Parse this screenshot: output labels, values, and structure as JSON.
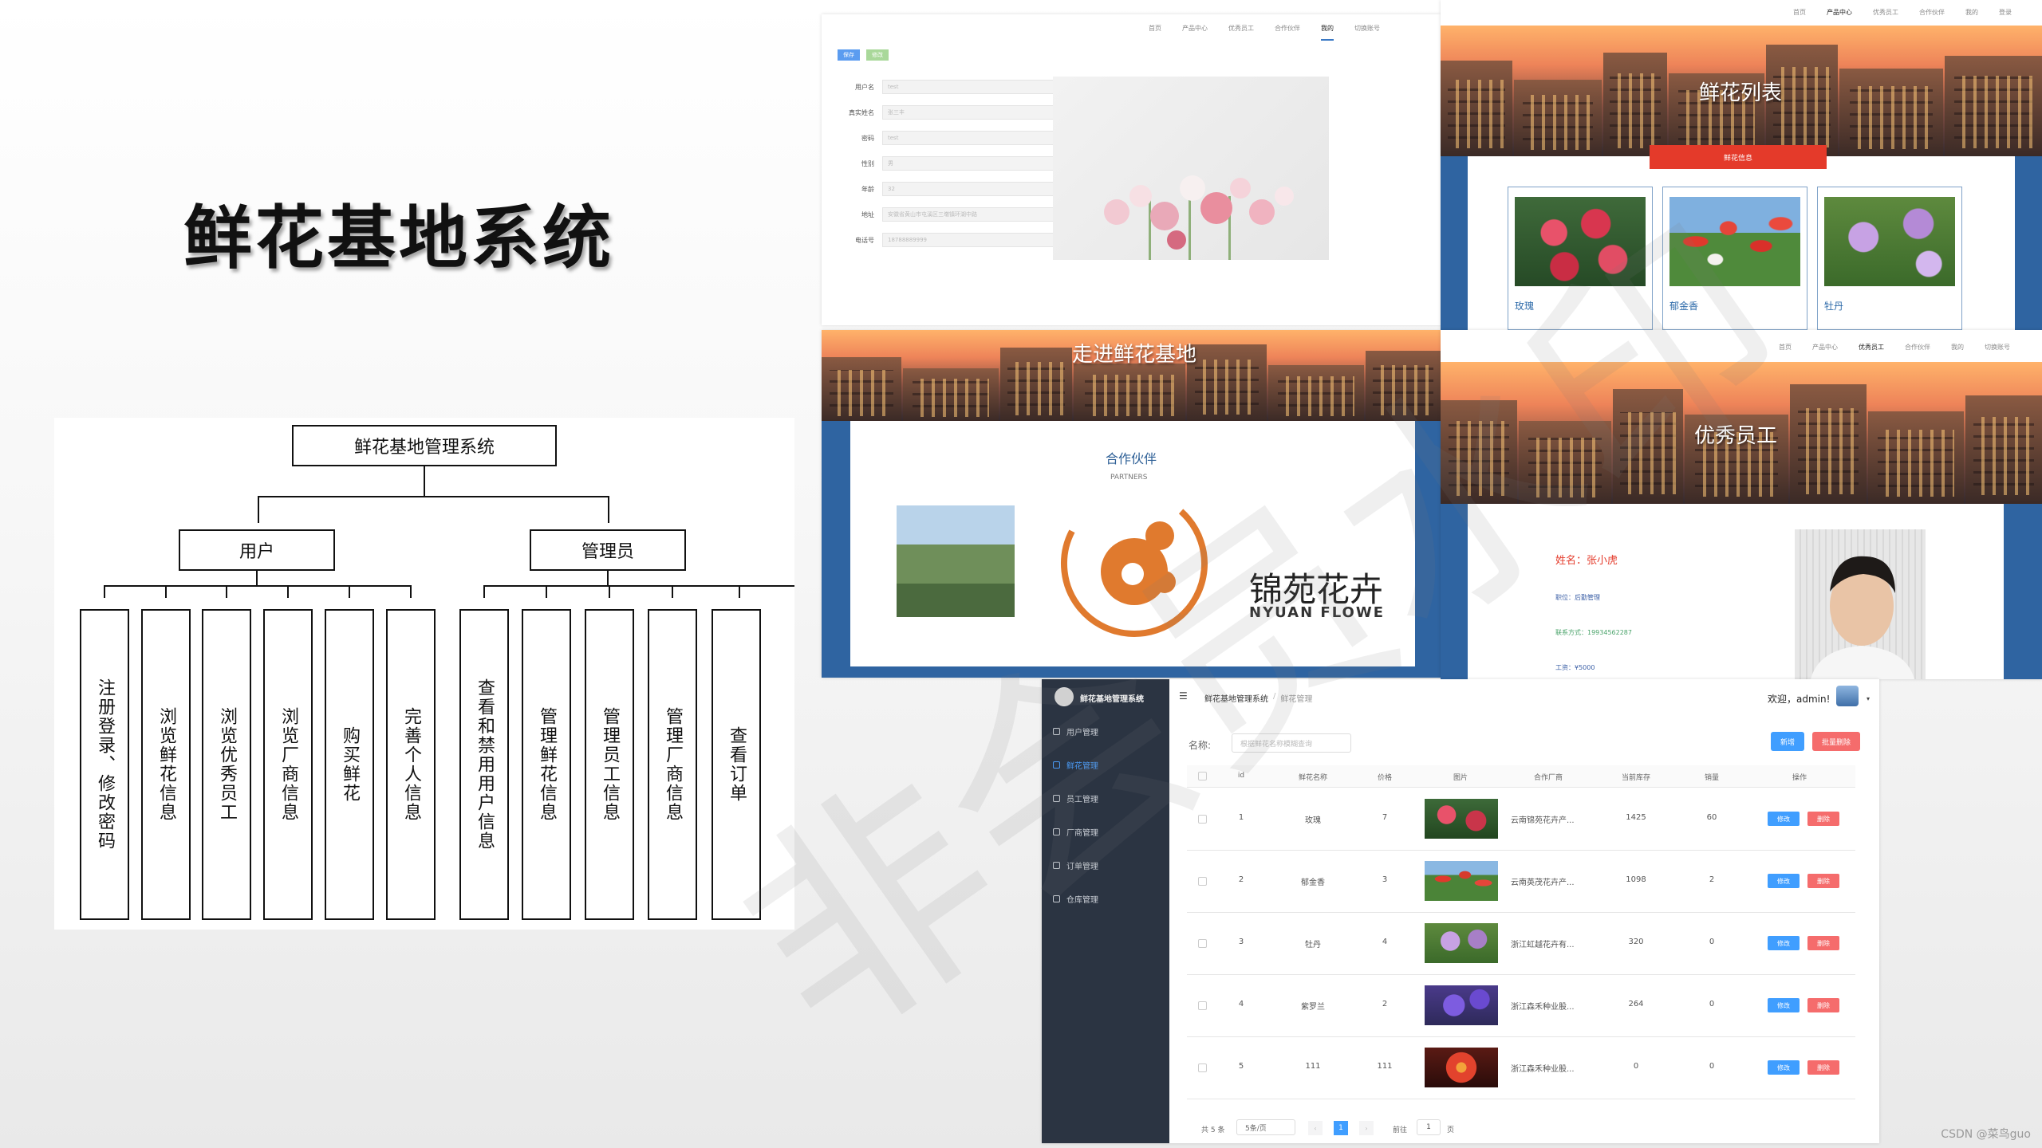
{
  "slide_title": "鲜花基地系统",
  "org_chart": {
    "root": "鲜花基地管理系统",
    "branches": [
      {
        "label": "用户",
        "children": [
          "注册登录、修改密码",
          "浏览鲜花信息",
          "浏览优秀员工",
          "浏览厂商信息",
          "购买鲜花",
          "完善个人信息"
        ]
      },
      {
        "label": "管理员",
        "children": [
          "查看和禁用用户信息",
          "管理鲜花信息",
          "管理员工信息",
          "管理厂商信息",
          "查看订单"
        ]
      }
    ]
  },
  "profile_panel": {
    "nav": [
      "首页",
      "产品中心",
      "优秀员工",
      "合作伙伴",
      "我的",
      "切换账号"
    ],
    "nav_active": "我的",
    "buttons": [
      "保存",
      "修改"
    ],
    "fields": [
      {
        "label": "用户名",
        "value": "test"
      },
      {
        "label": "真实姓名",
        "value": "张三丰"
      },
      {
        "label": "密码",
        "value": "test"
      },
      {
        "label": "性别",
        "value": "男"
      },
      {
        "label": "年龄",
        "value": "32"
      },
      {
        "label": "地址",
        "value": "安徽省黄山市屯溪区三墩镇环湖中路"
      },
      {
        "label": "电话号",
        "value": "18788889999"
      }
    ]
  },
  "flower_list_panel": {
    "nav": [
      "首页",
      "产品中心",
      "优秀员工",
      "合作伙伴",
      "我的",
      "登录"
    ],
    "nav_active": "产品中心",
    "banner_title": "鲜花列表",
    "tab_label": "鲜花信息",
    "cards": [
      {
        "name": "玫瑰",
        "color": "#d8364f"
      },
      {
        "name": "郁金香",
        "color": "#e0392c"
      },
      {
        "name": "牡丹",
        "color": "#b48ad6"
      }
    ]
  },
  "partners_panel": {
    "banner_title": "走进鲜花基地",
    "section_title": "合作伙伴",
    "section_sub": "PARTNERS",
    "partner_text_cn": "锦苑花卉",
    "partner_text_en": "NYUAN FLOWE"
  },
  "staff_panel": {
    "nav": [
      "首页",
      "产品中心",
      "优秀员工",
      "合作伙伴",
      "我的",
      "切换账号"
    ],
    "nav_active": "优秀员工",
    "banner_title": "优秀员工",
    "name_line": "姓名：张小虎",
    "position_line": "职位：后勤管理",
    "contact_line": "联系方式：19934562287",
    "salary_line": "工资：¥5000"
  },
  "admin_panel": {
    "system_name": "鲜花基地管理系统",
    "breadcrumb": [
      "鲜花基地管理系统",
      "/",
      "鲜花管理"
    ],
    "welcome": "欢迎，admin!",
    "menu": [
      "用户管理",
      "鲜花管理",
      "员工管理",
      "厂商管理",
      "订单管理",
      "仓库管理"
    ],
    "menu_active": "鲜花管理",
    "search_label": "名称:",
    "search_placeholder": "根据鲜花名称模糊查询",
    "btn_add": "新增",
    "btn_batch_delete": "批量删除",
    "columns": [
      "id",
      "鲜花名称",
      "价格",
      "图片",
      "合作厂商",
      "当前库存",
      "销量",
      "操作"
    ],
    "rows": [
      {
        "id": "1",
        "name": "玫瑰",
        "price": "7",
        "vendor": "云南锦苑花卉产...",
        "stock": "1425",
        "sales": "60",
        "color": "#c9354a"
      },
      {
        "id": "2",
        "name": "郁金香",
        "price": "3",
        "vendor": "云南英茂花卉产...",
        "stock": "1098",
        "sales": "2",
        "color": "#d63a2c"
      },
      {
        "id": "3",
        "name": "牡丹",
        "price": "4",
        "vendor": "浙江虹越花卉有...",
        "stock": "320",
        "sales": "0",
        "color": "#a77fc7"
      },
      {
        "id": "4",
        "name": "紫罗兰",
        "price": "2",
        "vendor": "浙江森禾种业股...",
        "stock": "264",
        "sales": "0",
        "color": "#6a4ad0"
      },
      {
        "id": "5",
        "name": "111",
        "price": "111",
        "vendor": "浙江森禾种业股...",
        "stock": "0",
        "sales": "0",
        "color": "#e2432d"
      }
    ],
    "btn_edit": "修改",
    "btn_delete": "删除",
    "pager_total": "共 5 条",
    "pager_size": "5条/页",
    "pager_page": "1",
    "pager_goto": "前往",
    "pager_goto_val": "1",
    "pager_unit": "页"
  },
  "watermark": "非会员水印",
  "footer": "CSDN @菜鸟guo"
}
